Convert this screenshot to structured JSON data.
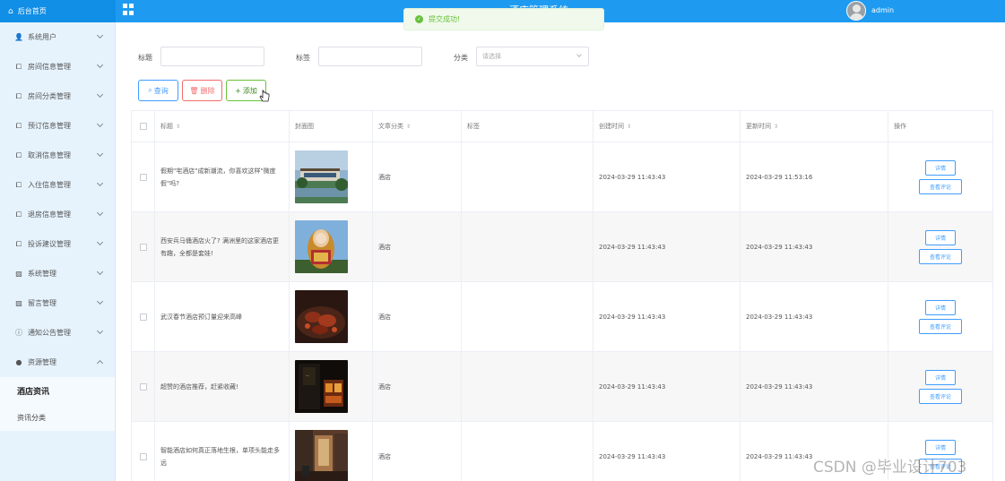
{
  "header": {
    "home_label": "后台首页",
    "system_title": "酒店管理系统",
    "username": "admin"
  },
  "toast": {
    "message": "提交成功!"
  },
  "sidebar": {
    "items": [
      {
        "label": "系统用户",
        "icon": "user-icon",
        "glyph": "👤"
      },
      {
        "label": "房间信息管理",
        "icon": "box-icon",
        "glyph": "⧠"
      },
      {
        "label": "房间分类管理",
        "icon": "box-icon",
        "glyph": "⧠"
      },
      {
        "label": "预订信息管理",
        "icon": "box-icon",
        "glyph": "⧠"
      },
      {
        "label": "取消信息管理",
        "icon": "box-icon",
        "glyph": "⧠"
      },
      {
        "label": "入住信息管理",
        "icon": "box-icon",
        "glyph": "⧠"
      },
      {
        "label": "退房信息管理",
        "icon": "box-icon",
        "glyph": "⧠"
      },
      {
        "label": "投诉建议管理",
        "icon": "box-icon",
        "glyph": "⧠"
      },
      {
        "label": "系统管理",
        "icon": "picture-icon",
        "glyph": "▨"
      },
      {
        "label": "留言管理",
        "icon": "picture-icon",
        "glyph": "▨"
      },
      {
        "label": "通知公告管理",
        "icon": "info-icon",
        "glyph": "ⓘ"
      },
      {
        "label": "资源管理",
        "icon": "location-icon",
        "glyph": "●"
      }
    ],
    "sub_items": [
      {
        "label": "酒店资讯",
        "active": true
      },
      {
        "label": "资讯分类",
        "active": false
      }
    ]
  },
  "filters": {
    "title_label": "标题",
    "tag_label": "标签",
    "category_label": "分类",
    "category_placeholder": "请选择",
    "title_value": "",
    "tag_value": ""
  },
  "toolbar": {
    "query_label": "查询",
    "delete_label": "删除",
    "add_label": "添加"
  },
  "table": {
    "headers": {
      "title": "标题",
      "cover": "封面图",
      "category": "文章分类",
      "tags": "标签",
      "created": "创建时间",
      "updated": "更新时间",
      "ops": "操作"
    },
    "detail_label": "详情",
    "review_label": "查看评论",
    "rows": [
      {
        "title": "假期\"宅酒店\"成新潮流，你喜欢这样\"微度假\"吗?",
        "category": "酒店",
        "tags": "",
        "created": "2024-03-29 11:43:43",
        "updated": "2024-03-29 11:53:16",
        "cover": "hotel-building"
      },
      {
        "title": "西安兵马俑酒店火了? 满洲里的这家酒店更有趣，全都是套娃!",
        "category": "酒店",
        "tags": "",
        "created": "2024-03-29 11:43:43",
        "updated": "2024-03-29 11:43:43",
        "cover": "matryoshka-hotel"
      },
      {
        "title": "武汉春节酒店预订量迎来高峰",
        "category": "酒店",
        "tags": "",
        "created": "2024-03-29 11:43:43",
        "updated": "2024-03-29 11:43:43",
        "cover": "food-plate"
      },
      {
        "title": "超赞的酒店推荐，赶紧收藏!",
        "category": "酒店",
        "tags": "",
        "created": "2024-03-29 11:43:43",
        "updated": "2024-03-29 11:43:43",
        "cover": "night-facade"
      },
      {
        "title": "智能酒店如何真正落地生根，单项头能走多远",
        "category": "酒店",
        "tags": "",
        "created": "2024-03-29 11:43:43",
        "updated": "2024-03-29 11:43:43",
        "cover": "smart-room"
      }
    ]
  },
  "watermark": "CSDN @毕业设计703",
  "colors": {
    "topbar": "#1e9bf0",
    "sidebar_bg": "#e6f3fd",
    "primary": "#409eff",
    "danger": "#f56c6c",
    "success": "#67c23a"
  }
}
